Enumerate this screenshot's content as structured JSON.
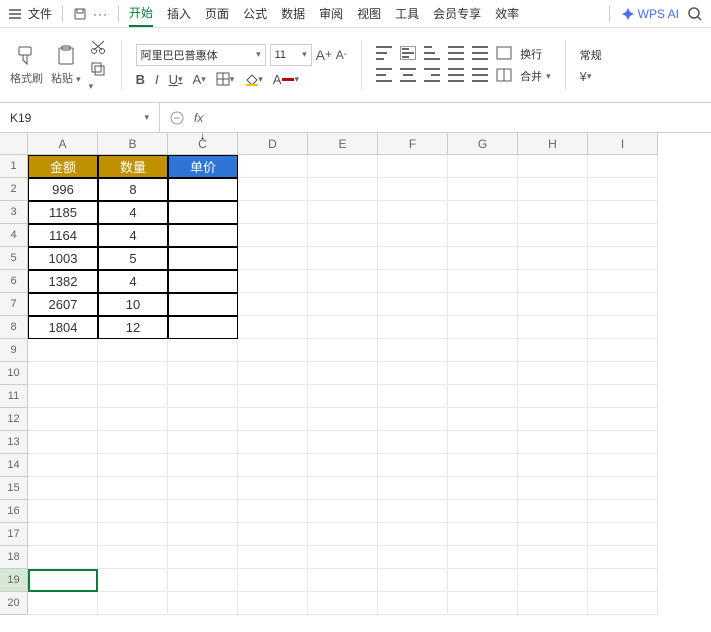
{
  "topbar": {
    "file": "文件"
  },
  "tabs": {
    "start": "开始",
    "insert": "插入",
    "page": "页面",
    "formula": "公式",
    "data": "数据",
    "review": "审阅",
    "view": "视图",
    "tools": "工具",
    "member": "会员专享",
    "efficiency": "效率"
  },
  "ai": {
    "label": "WPS AI"
  },
  "ribbon": {
    "format_painter": "格式刷",
    "paste": "粘贴",
    "font": "阿里巴巴普惠体",
    "size": "11",
    "wrap": "换行",
    "merge": "合并",
    "general": "常规"
  },
  "namebox": {
    "ref": "K19"
  },
  "columns": [
    "A",
    "B",
    "C",
    "D",
    "E",
    "F",
    "G",
    "H",
    "I"
  ],
  "headers": {
    "a": "金额",
    "b": "数量",
    "c": "单价"
  },
  "data": [
    {
      "a": "996",
      "b": "8"
    },
    {
      "a": "1185",
      "b": "4"
    },
    {
      "a": "1164",
      "b": "4"
    },
    {
      "a": "1003",
      "b": "5"
    },
    {
      "a": "1382",
      "b": "4"
    },
    {
      "a": "2607",
      "b": "10"
    },
    {
      "a": "1804",
      "b": "12"
    }
  ],
  "rows": [
    1,
    2,
    3,
    4,
    5,
    6,
    7,
    8,
    9,
    10,
    11,
    12,
    13,
    14,
    15,
    16,
    17,
    18,
    19,
    20
  ],
  "chart_data": {
    "type": "table",
    "columns": [
      "金额",
      "数量",
      "单价"
    ],
    "rows": [
      [
        996,
        8,
        null
      ],
      [
        1185,
        4,
        null
      ],
      [
        1164,
        4,
        null
      ],
      [
        1003,
        5,
        null
      ],
      [
        1382,
        4,
        null
      ],
      [
        2607,
        10,
        null
      ],
      [
        1804,
        12,
        null
      ]
    ]
  }
}
